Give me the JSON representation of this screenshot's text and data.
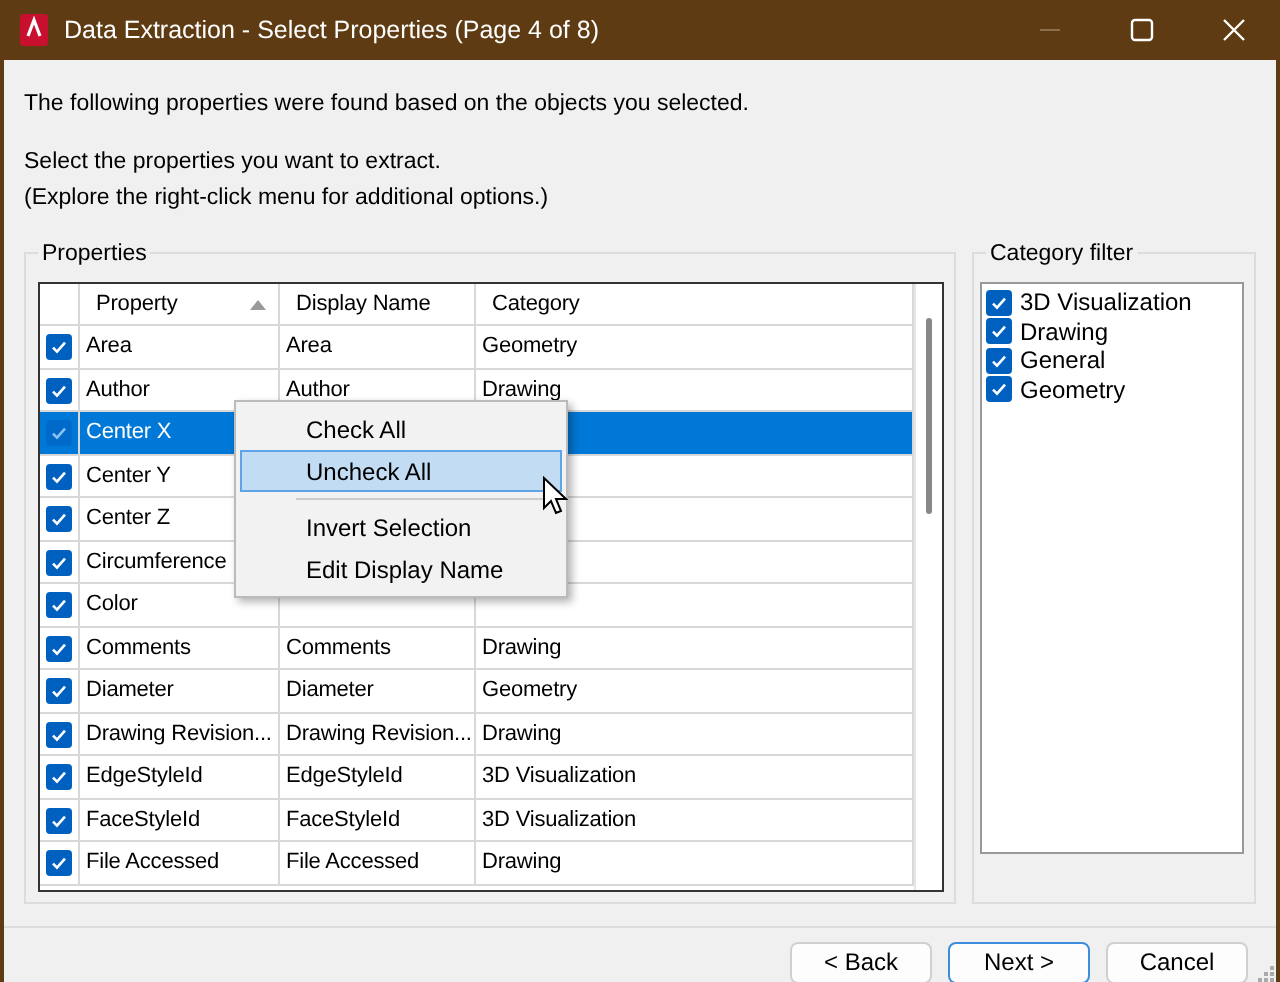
{
  "window": {
    "title": "Data Extraction - Select Properties (Page 4 of 8)"
  },
  "intro": "The following properties were found based on the objects you selected.",
  "instructions": [
    "Select the properties you want to extract.",
    "(Explore the right-click menu for additional options.)"
  ],
  "properties": {
    "title": "Properties",
    "columns": [
      {
        "label": "Property",
        "sorted": true
      },
      {
        "label": "Display Name",
        "sorted": false
      },
      {
        "label": "Category",
        "sorted": false
      }
    ],
    "rows": [
      {
        "checked": true,
        "selected": false,
        "cells": [
          "Area",
          "Area",
          "Geometry"
        ]
      },
      {
        "checked": true,
        "selected": false,
        "cells": [
          "Author",
          "Author",
          "Drawing"
        ]
      },
      {
        "checked": true,
        "selected": true,
        "cells": [
          "Center X"
        ]
      },
      {
        "checked": true,
        "selected": false,
        "cells": [
          "Center Y"
        ]
      },
      {
        "checked": true,
        "selected": false,
        "cells": [
          "Center Z"
        ]
      },
      {
        "checked": true,
        "selected": false,
        "cells": [
          "Circumference"
        ]
      },
      {
        "checked": true,
        "selected": false,
        "cells": [
          "Color"
        ]
      },
      {
        "checked": true,
        "selected": false,
        "cells": [
          "Comments",
          "Comments",
          "Drawing"
        ]
      },
      {
        "checked": true,
        "selected": false,
        "cells": [
          "Diameter",
          "Diameter",
          "Geometry"
        ]
      },
      {
        "checked": true,
        "selected": false,
        "cells": [
          "Drawing Revision...",
          "Drawing Revision...",
          "Drawing"
        ]
      },
      {
        "checked": true,
        "selected": false,
        "cells": [
          "EdgeStyleId",
          "EdgeStyleId",
          "3D Visualization"
        ]
      },
      {
        "checked": true,
        "selected": false,
        "cells": [
          "FaceStyleId",
          "FaceStyleId",
          "3D Visualization"
        ]
      },
      {
        "checked": true,
        "selected": false,
        "cells": [
          "File Accessed",
          "File Accessed",
          "Drawing"
        ]
      }
    ]
  },
  "context_menu": {
    "items": [
      {
        "kind": "item",
        "label": "Check All",
        "highlighted": false
      },
      {
        "kind": "item",
        "label": "Uncheck All",
        "highlighted": true
      },
      {
        "kind": "separator"
      },
      {
        "kind": "item",
        "label": "Invert Selection",
        "highlighted": false
      },
      {
        "kind": "item",
        "label": "Edit Display Name",
        "highlighted": false
      }
    ]
  },
  "category_filter": {
    "title": "Category filter",
    "items": [
      {
        "label": "3D Visualization",
        "checked": true
      },
      {
        "label": "Drawing",
        "checked": true
      },
      {
        "label": "General",
        "checked": true
      },
      {
        "label": "Geometry",
        "checked": true
      }
    ]
  },
  "buttons": [
    {
      "label": "< Back",
      "default": false
    },
    {
      "label": "Next >",
      "default": true
    },
    {
      "label": "Cancel",
      "default": false
    }
  ]
}
